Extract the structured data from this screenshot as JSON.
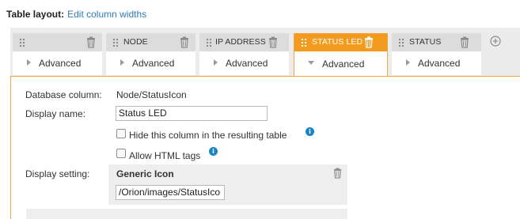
{
  "header": {
    "title": "Table layout:",
    "link": "Edit column widths"
  },
  "columns": [
    {
      "name": "",
      "advanced": "Advanced",
      "active": false
    },
    {
      "name": "NODE",
      "advanced": "Advanced",
      "active": false
    },
    {
      "name": "IP ADDRESS",
      "advanced": "Advanced",
      "active": false
    },
    {
      "name": "STATUS LED",
      "advanced": "Advanced",
      "active": true
    },
    {
      "name": "STATUS",
      "advanced": "Advanced",
      "active": false
    }
  ],
  "details": {
    "database_column_label": "Database column:",
    "database_column_value": "Node/StatusIcon",
    "display_name_label": "Display name:",
    "display_name_value": "Status LED",
    "hide_column_label": "Hide this column in the resulting table",
    "allow_html_label": "Allow HTML tags",
    "display_setting_label": "Display setting:",
    "display_setting_value": "Generic Icon",
    "icon_path_value": "/Orion/images/StatusIco"
  },
  "colors": {
    "accent": "#f39a1f",
    "link": "#2f7ab8",
    "info": "#1b83c8"
  }
}
